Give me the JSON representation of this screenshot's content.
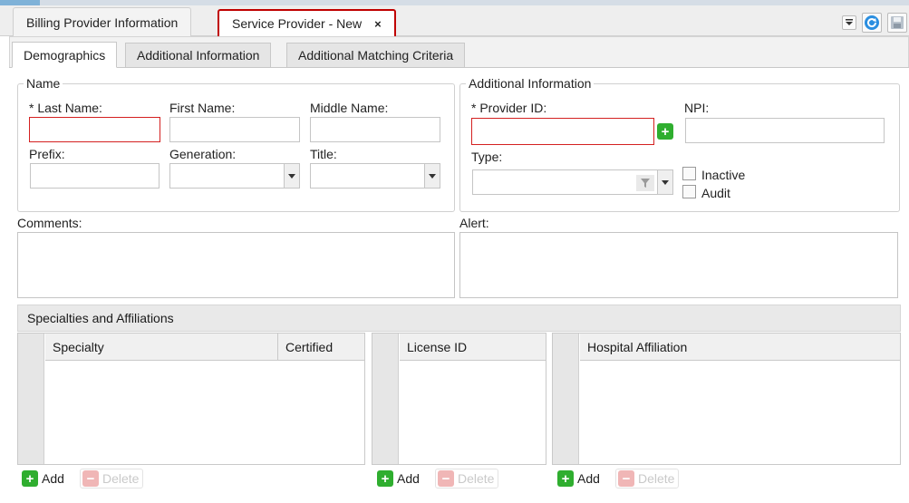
{
  "doc_tabs": [
    {
      "label": "Billing Provider Information"
    },
    {
      "label": "Service Provider - New",
      "close": "×"
    }
  ],
  "tabs": [
    {
      "label": "Demographics"
    },
    {
      "label": "Additional Information"
    },
    {
      "label": "Additional Matching Criteria"
    }
  ],
  "name_group": {
    "legend": "Name",
    "last_name": "* Last Name:",
    "first_name": "First Name:",
    "middle_name": "Middle Name:",
    "prefix": "Prefix:",
    "generation": "Generation:",
    "title": "Title:"
  },
  "additional_group": {
    "legend": "Additional Information",
    "provider_id": "* Provider ID:",
    "npi": "NPI:",
    "type": "Type:",
    "inactive": "Inactive",
    "audit": "Audit"
  },
  "comments_label": "Comments:",
  "alert_label": "Alert:",
  "specialties": {
    "title": "Specialties and Affiliations",
    "col_specialty": "Specialty",
    "col_certified": "Certified",
    "col_license": "License ID",
    "col_hospital": "Hospital Affiliation",
    "add": "Add",
    "delete": "Delete"
  }
}
